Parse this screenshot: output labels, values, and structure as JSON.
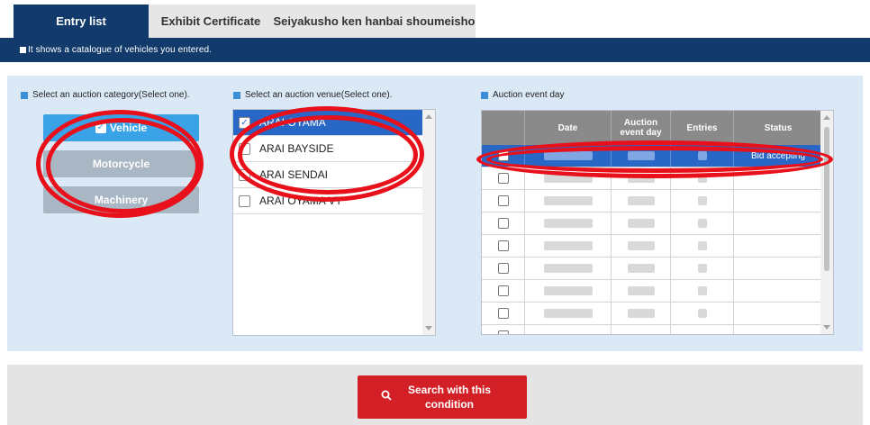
{
  "tabs": [
    {
      "label": "Entry list",
      "active": true
    },
    {
      "label": "Exhibit Certificate",
      "active": false
    },
    {
      "label": "Seiyakusho ken hanbai shoumeisho",
      "active": false
    }
  ],
  "info": "It shows a catalogue of vehicles you entered.",
  "category": {
    "title": "Select an auction category(Select one).",
    "items": [
      "Vehicle",
      "Motorcycle",
      "Machinery"
    ],
    "selected": "Vehicle"
  },
  "venue": {
    "title": "Select an auction venue(Select one).",
    "items": [
      "ARAI OYAMA",
      "ARAI BAYSIDE",
      "ARAI SENDAI",
      "ARAI OYAMA VT"
    ],
    "selected": "ARAI OYAMA"
  },
  "event": {
    "title": "Auction event day",
    "headers": [
      "Date",
      "Auction event day",
      "Entries",
      "Status"
    ],
    "first_row_status": "Bid accepting"
  },
  "search_button": "Search with this condition",
  "colors": {
    "navy": "#123a6b",
    "selected_blue": "#2967c7",
    "accent_blue": "#3aa2e6",
    "search_red": "#d32026",
    "annotation_red": "#e8101a"
  }
}
